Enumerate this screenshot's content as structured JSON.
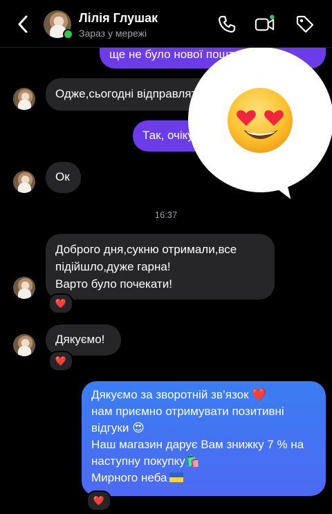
{
  "header": {
    "name": "Лілія Глушак",
    "status": "Зараз у мережі",
    "icons": [
      "back-chevron-icon",
      "phone-icon",
      "video-camera-icon",
      "tag-icon"
    ],
    "online_color": "#35c35a"
  },
  "messages": {
    "out_1": "ще не було нової пошти",
    "in_1": "Одже,сьогодні відправлять",
    "out_2": "Так, очікуємо",
    "in_2": "Ок",
    "timestamp": "16:37",
    "in_3": [
      "Доброго дня,сукню отримали,все",
      "підійшло,дуже гарна!",
      "Варто було почекати!"
    ],
    "in_4": "Дякуємо!",
    "out_3": [
      "Дякуємо за зворотній зв’язок ❤️",
      "нам приємно отримувати позитивні відгуки 😍",
      "Наш магазин дарує Вам знижку 7 % на наступну покупку🛍️",
      "Мирного неба"
    ]
  },
  "reactions": {
    "in_3": "❤️",
    "in_4": "❤️",
    "out_3": "❤️"
  },
  "overlay": {
    "emoji": "heart-eyes-emoji"
  },
  "colors": {
    "outgoing_purple": "#6b3ce8",
    "outgoing_blue": "#3b7df2",
    "incoming_gray": "#262628",
    "flag_blue": "#2d63c8",
    "flag_yellow": "#f5d33a"
  }
}
